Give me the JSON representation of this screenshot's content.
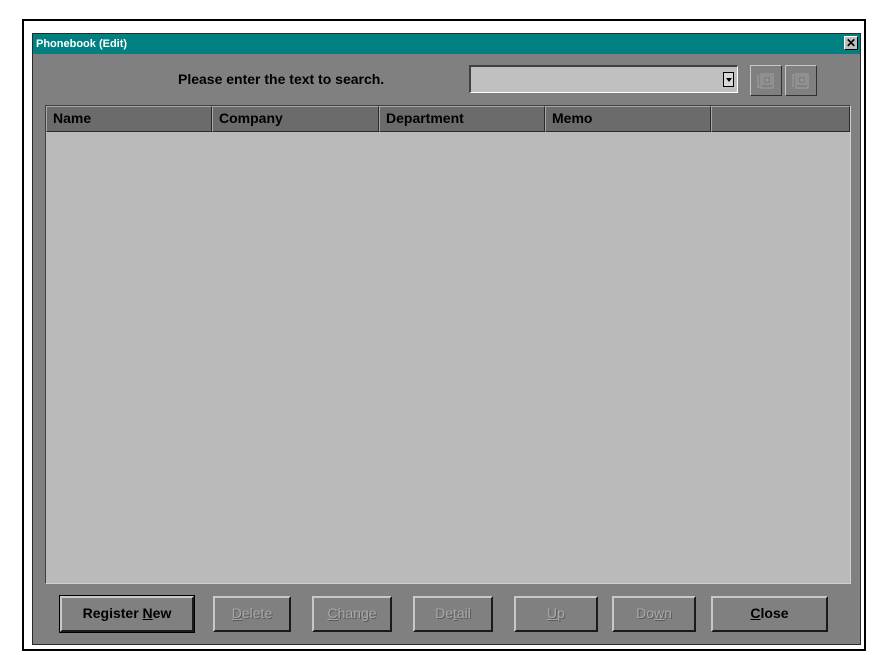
{
  "window": {
    "title": "Phonebook (Edit)",
    "close_glyph": "✕"
  },
  "search": {
    "label": "Please enter the text to search.",
    "value": "",
    "find_up_icon": "search-up-icon",
    "find_down_icon": "search-down-icon"
  },
  "list": {
    "columns": [
      "Name",
      "Company",
      "Department",
      "Memo",
      ""
    ],
    "rows": []
  },
  "buttons": {
    "register_new": {
      "pre": "Register ",
      "mnemonic": "N",
      "post": "ew",
      "enabled": true
    },
    "delete": {
      "pre": "",
      "mnemonic": "D",
      "post": "elete",
      "enabled": false
    },
    "change": {
      "pre": "",
      "mnemonic": "C",
      "post": "hange",
      "enabled": false
    },
    "detail": {
      "pre": "De",
      "mnemonic": "t",
      "post": "ail",
      "enabled": false
    },
    "up": {
      "pre": "",
      "mnemonic": "U",
      "post": "p",
      "enabled": false
    },
    "down": {
      "pre": "Do",
      "mnemonic": "w",
      "post": "n",
      "enabled": false
    },
    "close": {
      "pre": "",
      "mnemonic": "C",
      "post": "lose",
      "enabled": true
    }
  },
  "colors": {
    "title_bar": "#008080",
    "dialog_bg": "#808080",
    "list_bg": "#bababa"
  }
}
